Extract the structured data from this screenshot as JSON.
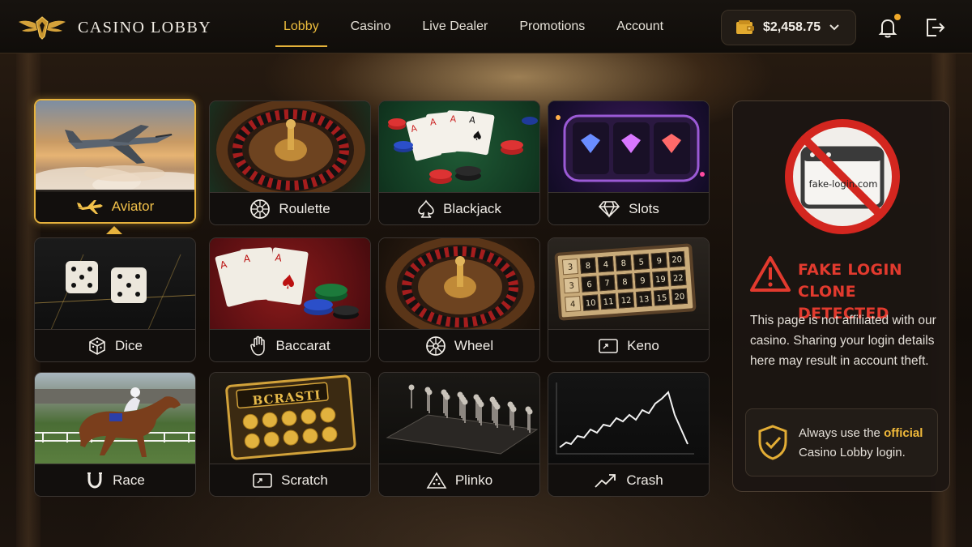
{
  "brand": {
    "name": "CASINO LOBBY"
  },
  "nav": {
    "items": [
      {
        "label": "Lobby",
        "active": true
      },
      {
        "label": "Casino",
        "active": false
      },
      {
        "label": "Live Dealer",
        "active": false
      },
      {
        "label": "Promotions",
        "active": false
      },
      {
        "label": "Account",
        "active": false
      }
    ]
  },
  "wallet": {
    "balance": "$2,458.75",
    "icon": "wallet-icon"
  },
  "header_icons": {
    "notifications": "bell-icon",
    "logout": "logout-icon"
  },
  "games": [
    {
      "label": "Aviator",
      "icon": "plane-icon",
      "selected": true
    },
    {
      "label": "Roulette",
      "icon": "roulette-icon"
    },
    {
      "label": "Blackjack",
      "icon": "spade-icon"
    },
    {
      "label": "Slots",
      "icon": "diamond-icon"
    },
    {
      "label": "Dice",
      "icon": "dice-icon"
    },
    {
      "label": "Baccarat",
      "icon": "hand-icon"
    },
    {
      "label": "Wheel",
      "icon": "wheel-icon"
    },
    {
      "label": "Keno",
      "icon": "ticket-icon"
    },
    {
      "label": "Race",
      "icon": "horseshoe-icon"
    },
    {
      "label": "Scratch",
      "icon": "ticket-icon"
    },
    {
      "label": "Plinko",
      "icon": "pyramid-icon"
    },
    {
      "label": "Crash",
      "icon": "trend-up-icon"
    }
  ],
  "art_text": {
    "scratch_card": "BCRASTI",
    "keno_numbers": [
      [
        "3",
        "8",
        "4",
        "8",
        "5",
        "9",
        "20"
      ],
      [
        "3",
        "6",
        "7",
        "8",
        "9",
        "19",
        "22"
      ],
      [
        "4",
        "10",
        "11",
        "12",
        "13",
        "15",
        "20"
      ]
    ]
  },
  "warning": {
    "fake_domain": "fake-login.com",
    "title_line1": "FAKE LOGIN",
    "title_line2": "CLONE DETECTED",
    "body": "This page is not affiliated with our casino. Sharing your login details here may result in account theft.",
    "tip_prefix": "Always use the ",
    "tip_highlight": "official",
    "tip_suffix": " Casino Lobby login."
  },
  "colors": {
    "accent_gold": "#e6b23d",
    "danger_red": "#e23a2e",
    "background": "#1a130d"
  }
}
